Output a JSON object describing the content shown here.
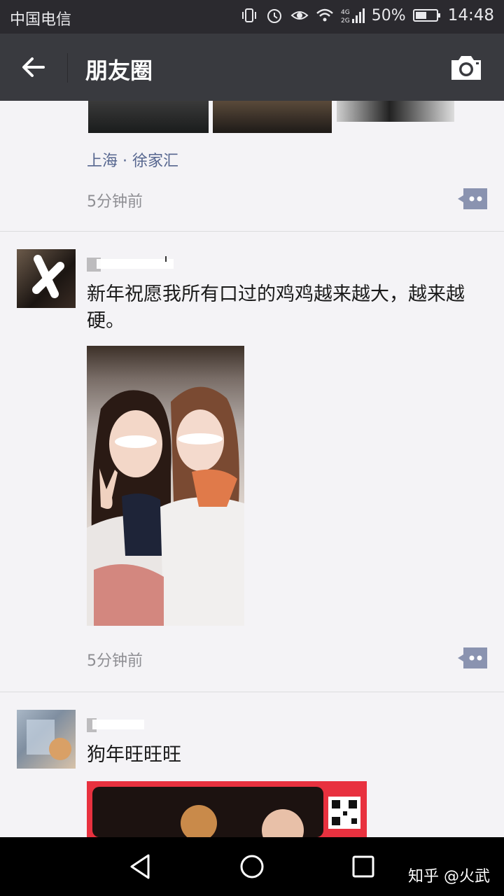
{
  "statusbar": {
    "carrier": "中国电信",
    "battery_percent": "50%",
    "time": "14:48",
    "network_label": "4G 2G",
    "icons": [
      "vibrate-icon",
      "alarm-icon",
      "eye-icon",
      "wifi-icon",
      "signal-icon",
      "battery-icon"
    ]
  },
  "navbar": {
    "title": "朋友圈",
    "back_icon": "back-arrow-icon",
    "camera_icon": "camera-icon",
    "background": "#393a3f"
  },
  "posts": [
    {
      "location": "上海 · 徐家汇",
      "time_ago": "5分钟前"
    },
    {
      "text": "新年祝愿我所有口过的鸡鸡越来越大，越来越硬。",
      "time_ago": "5分钟前"
    },
    {
      "text": "狗年旺旺旺"
    }
  ],
  "sysnav": {
    "watermark": "知乎 @火武",
    "buttons": [
      "back-triangle-icon",
      "home-circle-icon",
      "recents-square-icon"
    ]
  },
  "colors": {
    "link": "#56668f",
    "timestamp": "#8e8e93",
    "comment_button": "#8a93b0",
    "feed_bg": "#f4f3f6"
  }
}
